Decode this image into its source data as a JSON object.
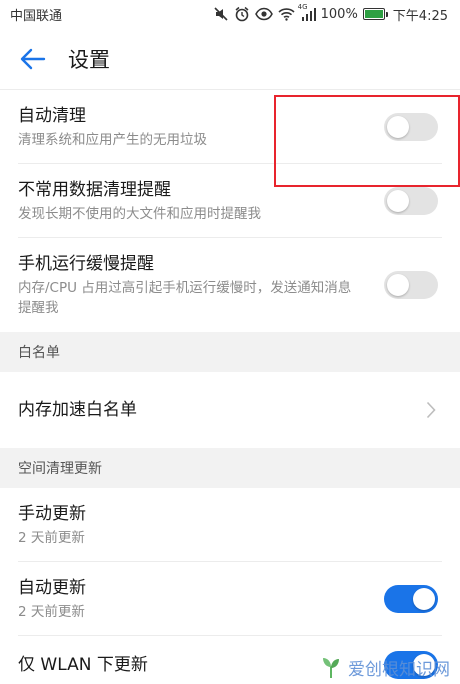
{
  "status_bar": {
    "carrier": "中国联通",
    "signal_tag": "4G",
    "battery_percent": "100%",
    "time": "下午4:25",
    "icons": [
      "mute-icon",
      "alarm-icon",
      "eye-comfort-icon",
      "wifi-icon",
      "cell-signal-icon",
      "battery-icon"
    ]
  },
  "app_bar": {
    "title": "设置",
    "back_icon": "arrow-left-icon"
  },
  "rows": {
    "auto_clean": {
      "title": "自动清理",
      "subtitle": "清理系统和应用产生的无用垃圾",
      "enabled": false
    },
    "uncommon_reminder": {
      "title": "不常用数据清理提醒",
      "subtitle": "发现长期不使用的大文件和应用时提醒我",
      "enabled": false
    },
    "slow_reminder": {
      "title": "手机运行缓慢提醒",
      "subtitle": "内存/CPU 占用过高引起手机运行缓慢时，发送通知消息提醒我",
      "enabled": false
    },
    "memory_whitelist": {
      "title": "内存加速白名单"
    },
    "manual_update": {
      "title": "手动更新",
      "subtitle": "2 天前更新"
    },
    "auto_update": {
      "title": "自动更新",
      "subtitle": "2 天前更新",
      "enabled": true
    },
    "wlan_only": {
      "title": "仅 WLAN 下更新",
      "enabled": true
    }
  },
  "sections": {
    "whitelist": "白名单",
    "space_clean_update": "空间清理更新"
  },
  "colors": {
    "accent": "#1a74e8",
    "toggle_off": "#e3e3e3",
    "annotation": "#e8242d",
    "section_bg": "#f2f2f2"
  },
  "watermark": {
    "text": "爱创根知识网",
    "icon": "sprout-logo-icon"
  }
}
